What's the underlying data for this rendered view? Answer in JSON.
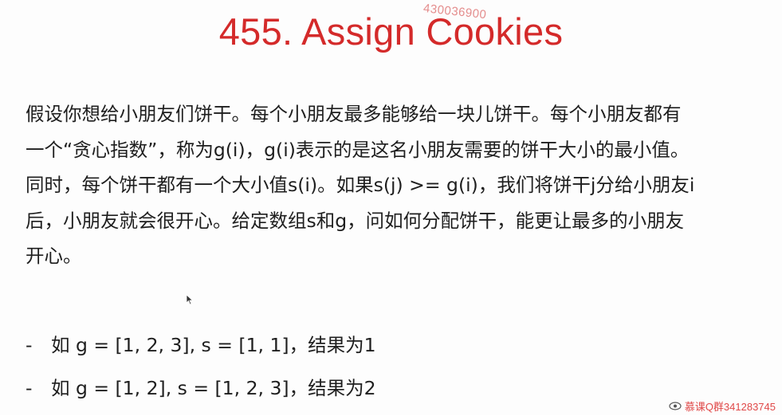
{
  "watermark_top": "430036900",
  "title": "455. Assign Cookies",
  "paragraph_lines": [
    "假设你想给小朋友们饼干。每个小朋友最多能够给一块儿饼干。每个小朋友都有",
    "一个“贪心指数”，称为g(i)，g(i)表示的是这名小朋友需要的饼干大小的最小值。",
    "同时，每个饼干都有一个大小值s(i)。如果s(j) >= g(i)，我们将饼干j分给小朋友i",
    "后，小朋友就会很开心。给定数组s和g，问如何分配饼干，能更让最多的小朋友",
    "开心。"
  ],
  "bullets": [
    {
      "dash": "-",
      "text": "如 g = [1, 2, 3], s = [1, 1]，结果为1"
    },
    {
      "dash": "-",
      "text": "如 g = [1, 2], s = [1, 2, 3]，结果为2"
    }
  ],
  "watermark_bottom": "慕课Q群341283745",
  "colors": {
    "title": "#d42a2a",
    "text": "#1e1e1e",
    "watermark": "#e04848"
  }
}
